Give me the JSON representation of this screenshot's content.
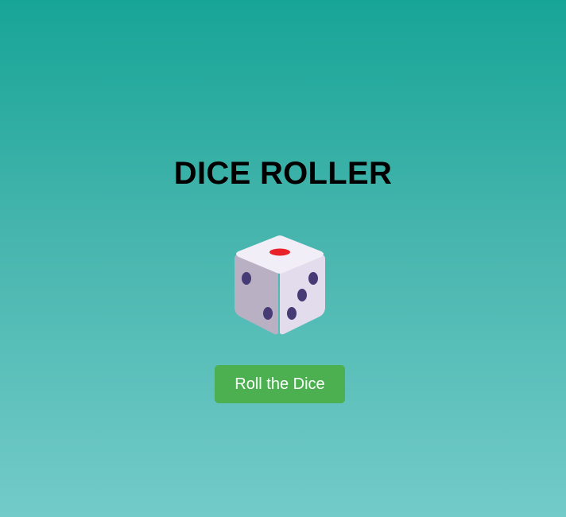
{
  "app": {
    "title": "DICE ROLLER"
  },
  "dice": {
    "icon": "die-icon",
    "top_face_value": 1,
    "colors": {
      "face_top": "#f1eef7",
      "face_left": "#b9b0c4",
      "face_right": "#e2dcec",
      "pip": "#473b75",
      "pip_accent": "#e9222a"
    }
  },
  "controls": {
    "roll_label": "Roll the Dice",
    "button_color": "#4caf50"
  },
  "theme": {
    "background_top": "#17a597",
    "background_bottom": "#73cbc9"
  }
}
